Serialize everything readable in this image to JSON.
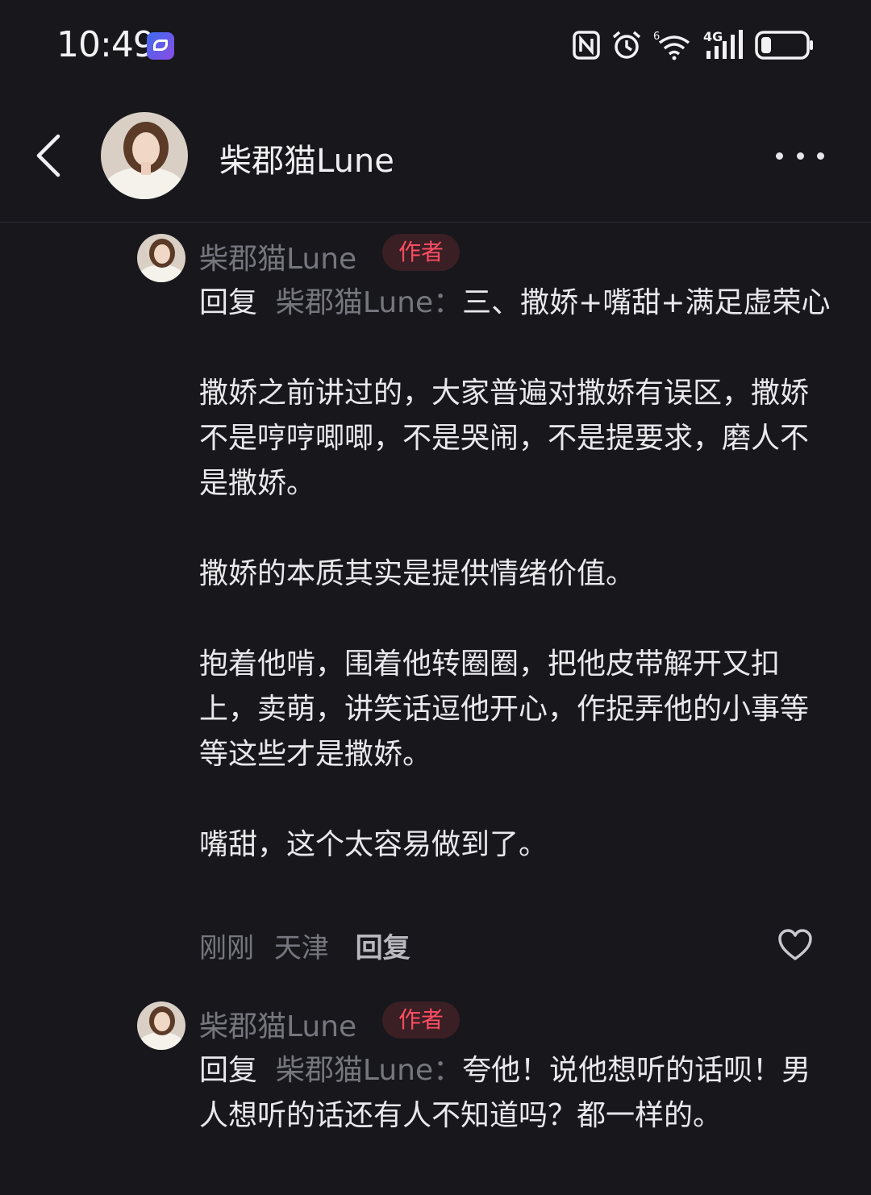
{
  "status_bar": {
    "time": "10:49",
    "icons": [
      "app-notification-icon",
      "nfc-icon",
      "alarm-icon",
      "wifi-icon",
      "signal-4g-icon",
      "battery-icon"
    ],
    "network": "4G",
    "wifi_tag": "6"
  },
  "header": {
    "title": "柴郡猫Lune",
    "back_icon": "chevron-left-icon",
    "more_icon": "more-dots-icon"
  },
  "comments": [
    {
      "author": "柴郡猫Lune",
      "badge": "作者",
      "reply_prefix": "回复",
      "reply_target": "柴郡猫Lune：",
      "paragraphs": [
        "三、撒娇+嘴甜+满足虚荣心",
        "撒娇之前讲过的，大家普遍对撒娇有误区，撒娇不是哼哼唧唧，不是哭闹，不是提要求，磨人不是撒娇。",
        "撒娇的本质其实是提供情绪价值。",
        "抱着他啃，围着他转圈圈，把他皮带解开又扣上，卖萌，讲笑话逗他开心，作捉弄他的小事等等这些才是撒娇。",
        "嘴甜，这个太容易做到了。"
      ],
      "time": "刚刚",
      "location": "天津",
      "reply_label": "回复"
    },
    {
      "author": "柴郡猫Lune",
      "badge": "作者",
      "reply_prefix": "回复",
      "reply_target": "柴郡猫Lune：",
      "paragraphs": [
        "夸他！说他想听的话呗！男人想听的话还有人不知道吗？都一样的。"
      ]
    }
  ],
  "colors": {
    "background": "#17171c",
    "secondary_text": "#76767e",
    "badge_text": "#ff4d63",
    "badge_bg": "#3a1f24"
  }
}
